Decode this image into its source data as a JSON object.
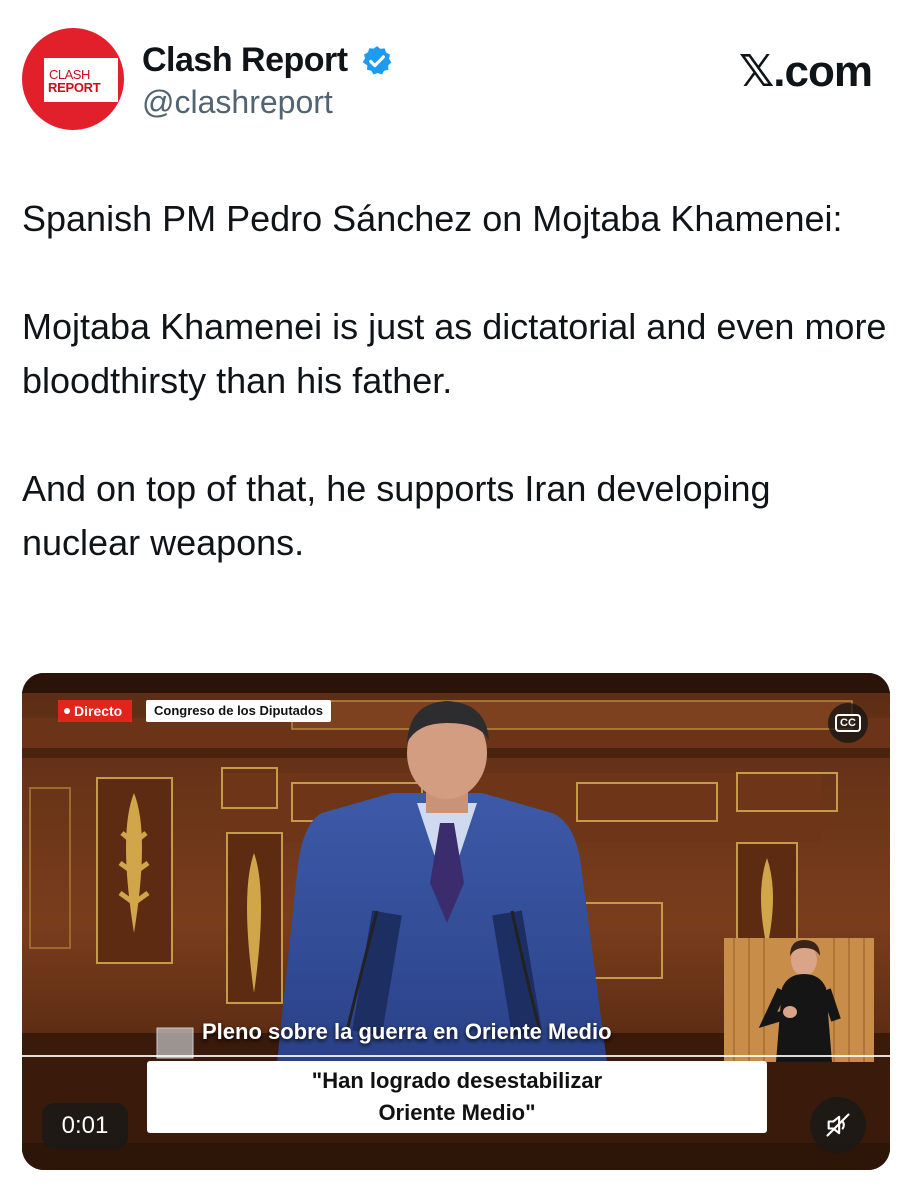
{
  "author": {
    "name": "Clash Report",
    "handle": "@clashreport",
    "avatar_top_text": "CLASH",
    "avatar_bottom_text": "REPORT",
    "verified": true
  },
  "brand": "𝕏.com",
  "tweet": {
    "paragraphs": [
      "Spanish PM Pedro Sánchez on Mojtaba Khamenei:",
      "Mojtaba Khamenei is just as dictatorial and even more bloodthirsty than his father.",
      "And on top of that, he supports Iran developing nuclear weapons."
    ]
  },
  "video": {
    "live_label": "Directo",
    "channel_label": "Congreso de los Diputados",
    "cc_label": "CC",
    "caption_title": "Pleno sobre la guerra en Oriente Medio",
    "quote_line1": "\"Han logrado desestabilizar",
    "quote_line2": "Oriente Medio\"",
    "timestamp": "0:01",
    "muted": true
  },
  "colors": {
    "brand_red": "#e2202b",
    "verified_blue": "#1d9bf0",
    "handle_gray": "#536471",
    "text": "#0f1419"
  },
  "icons": [
    "verified-badge-icon",
    "closed-captions-icon",
    "muted-speaker-icon"
  ]
}
